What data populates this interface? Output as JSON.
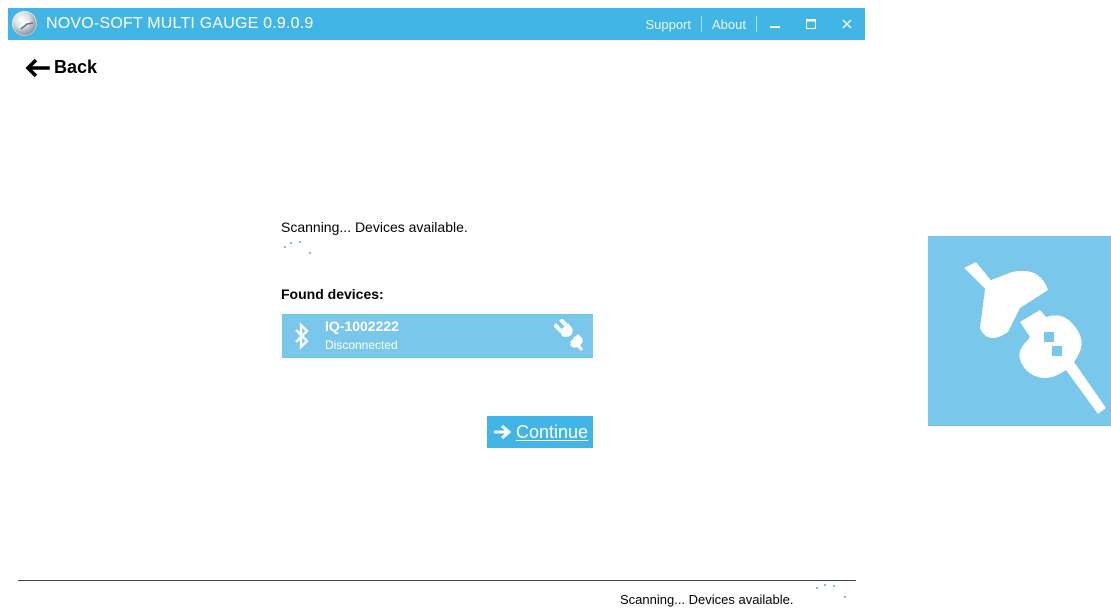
{
  "app": {
    "title": "NOVO-SOFT MULTI GAUGE 0.9.0.9",
    "logo_icon": "app-logo-icon"
  },
  "titlebar": {
    "menu": {
      "support_label": "Support",
      "about_label": "About"
    },
    "buttons": [
      "minimize-icon",
      "maximize-icon",
      "close-icon"
    ],
    "color": "#41b6e6"
  },
  "nav": {
    "back_label": "Back",
    "back_icon": "arrow-left-icon"
  },
  "scan": {
    "status_text": "Scanning... Devices available.",
    "indicator": "spinner-icon"
  },
  "devices": {
    "heading": "Found devices:",
    "items": [
      {
        "name": "IQ-1002222",
        "status": "Disconnected",
        "type_icon": "bluetooth-icon",
        "connection_icon": "unplugged-icon",
        "color": "#79c8ec"
      }
    ]
  },
  "actions": {
    "continue_label": "Continue",
    "continue_icon": "arrow-right-icon"
  },
  "statusbar": {
    "text": "Scanning... Devices available."
  },
  "zoom_panel": {
    "icon": "unplugged-icon",
    "color": "#79c8ec"
  }
}
